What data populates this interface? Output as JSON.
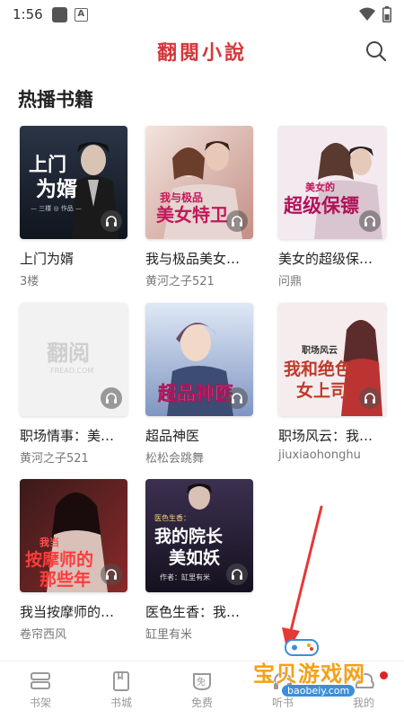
{
  "status_bar": {
    "time": "1:56",
    "a_badge": "A"
  },
  "header": {
    "title": "翻閱小說"
  },
  "section": {
    "title": "热播书籍"
  },
  "books": [
    {
      "title": "上门为婿",
      "author": "3楼",
      "cover_text": "上门为婿",
      "cover_sub": "— 三楼 ◎ 作品 —",
      "cover_colors": [
        "#1c2330",
        "#3a4557"
      ]
    },
    {
      "title": "我与极品美女…",
      "author": "黄河之子521",
      "cover_text": "美女特卫",
      "cover_sub": "我与极品",
      "cover_colors": [
        "#e9d6cf",
        "#c88f8a"
      ]
    },
    {
      "title": "美女的超级保…",
      "author": "问鼎",
      "cover_text": "超级保镖",
      "cover_sub": "美女的",
      "cover_colors": [
        "#f1e8ee",
        "#d9c2d0"
      ]
    },
    {
      "title": "职场情事：美…",
      "author": "黄河之子521",
      "cover_text": "翻阅",
      "cover_sub": "FREAD.COM",
      "cover_colors": [
        "#f2f2f2",
        "#ececec"
      ]
    },
    {
      "title": "超品神医",
      "author": "松松会跳舞",
      "cover_text": "超品神医",
      "cover_sub": "",
      "cover_colors": [
        "#c9d6ea",
        "#8b9fc4"
      ]
    },
    {
      "title": "职场风云：我…",
      "author": "jiuxiaohonghu",
      "cover_text": "我和绝色女上司",
      "cover_sub": "职场风云",
      "cover_colors": [
        "#f3eaea",
        "#d8c3c3"
      ]
    },
    {
      "title": "我当按摩师的…",
      "author": "卷帘西风",
      "cover_text": "按摩师的那些年",
      "cover_sub": "我当",
      "cover_colors": [
        "#2a1414",
        "#7a2a2a"
      ]
    },
    {
      "title": "医色生香：我…",
      "author": "缸里有米",
      "cover_text": "我的院长美如妖",
      "cover_sub": "作者：缸里有米",
      "cover_colors": [
        "#1f1a2e",
        "#4a3c5c"
      ]
    }
  ],
  "bottom_nav": [
    {
      "label": "书架",
      "icon": "shelf-icon"
    },
    {
      "label": "书城",
      "icon": "bookstore-icon"
    },
    {
      "label": "免费",
      "icon": "free-icon"
    },
    {
      "label": "听书",
      "icon": "audiobook-icon"
    },
    {
      "label": "我的",
      "icon": "profile-icon"
    }
  ],
  "watermark": {
    "text": "宝贝游戏网",
    "url": "baobeiy.com"
  },
  "colors": {
    "brand_red": "#d4373b",
    "nav_gray": "#999999"
  }
}
